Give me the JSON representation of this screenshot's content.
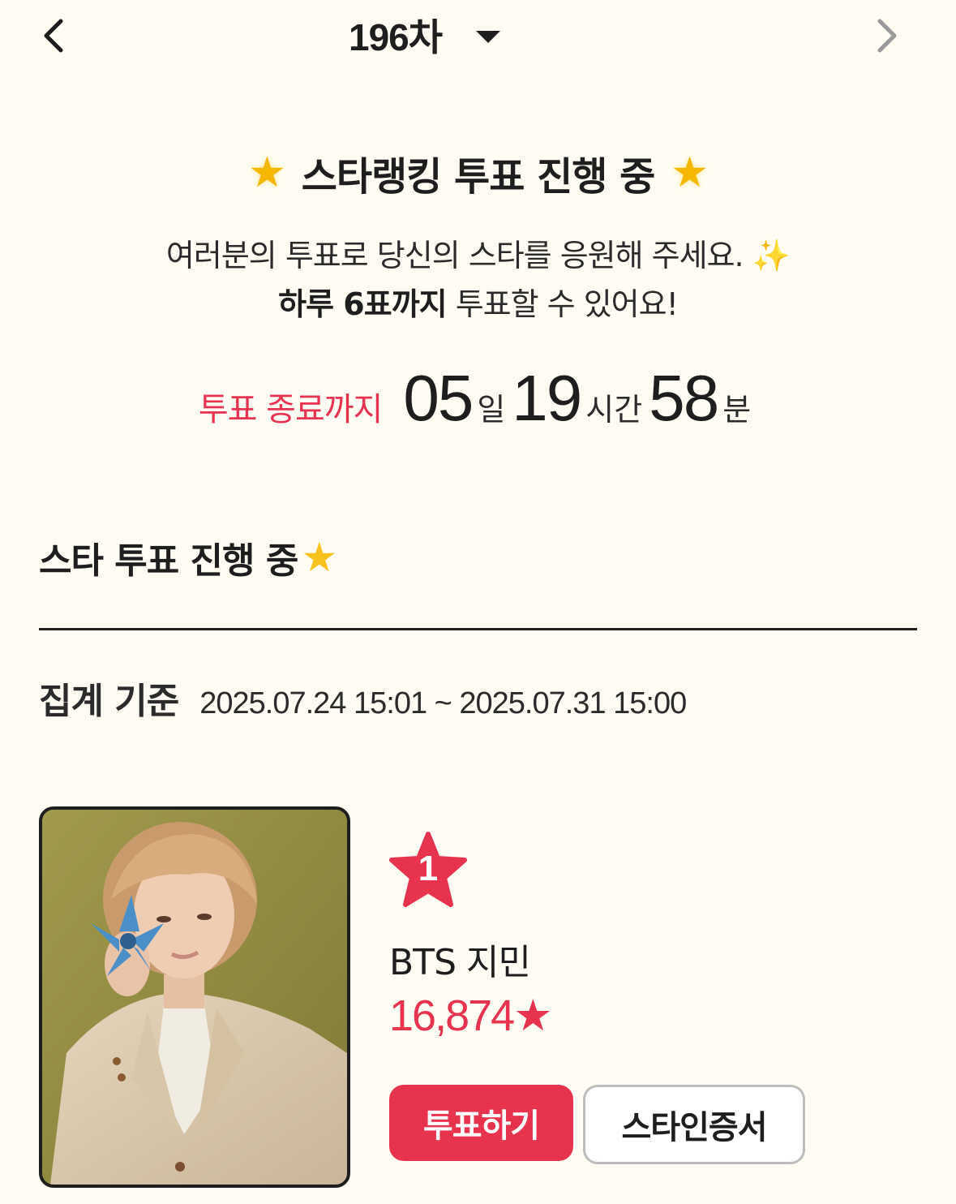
{
  "header": {
    "round_label": "196차",
    "back_icon": "chevron-left-icon",
    "next_icon": "chevron-right-icon",
    "dropdown_icon": "caret-down-icon"
  },
  "banner": {
    "title": "스타랭킹 투표 진행 중",
    "title_icon": "glowing-star-icon",
    "description_line1": "여러분의 투표로 당신의 스타를 응원해 주세요.",
    "description_icon": "sparkles-icon",
    "description_line2_bold": "하루 6표까지",
    "description_line2_rest": " 투표할 수 있어요!"
  },
  "countdown": {
    "label": "투표 종료까지",
    "days": "05",
    "days_unit": "일",
    "hours": "19",
    "hours_unit": "시간",
    "minutes": "58",
    "minutes_unit": "분"
  },
  "section": {
    "title": "스타 투표 진행 중",
    "title_icon": "star-icon",
    "period_label": "집계 기준",
    "period_value": "2025.07.24 15:01 ~ 2025.07.31 15:00"
  },
  "ranking": [
    {
      "rank": "1",
      "name": "BTS 지민",
      "votes": "16,874★",
      "vote_button": "투표하기",
      "certificate_button": "스타인증서"
    }
  ],
  "colors": {
    "background": "#fffcf3",
    "accent": "#e8334f",
    "text": "#1e1e1e"
  }
}
